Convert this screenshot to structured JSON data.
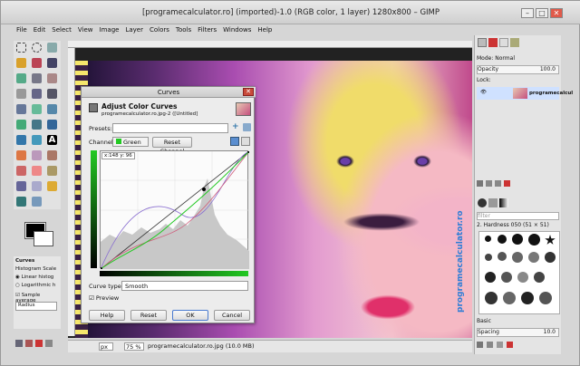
{
  "window": {
    "title": "[programecalculator.ro] (imported)-1.0 (RGB color, 1 layer) 1280x800 – GIMP"
  },
  "menubar": [
    "File",
    "Edit",
    "Select",
    "View",
    "Image",
    "Layer",
    "Colors",
    "Tools",
    "Filters",
    "Windows",
    "Help"
  ],
  "tool_options": {
    "title": "Curves",
    "histogram_scale": "Histogram Scale",
    "linear": "Linear histog",
    "log": "Logarithmic h",
    "sample": "Sample average",
    "radius": "Radius"
  },
  "canvas": {
    "watermark": "programecalculator.ro"
  },
  "statusbar": {
    "unit": "px",
    "zoom": "75 %",
    "info": "programecalculator.ro.jpg (10.0 MB)"
  },
  "curves": {
    "dialog_title": "Curves",
    "heading": "Adjust Color Curves",
    "subheading": "programecalculator.ro.jpg-2 ([Untitled]",
    "presets_label": "Presets:",
    "channel_label": "Channel:",
    "channel_value": "Green",
    "reset_channel": "Reset Channel",
    "coord": "x:148 y: 96",
    "curve_type_label": "Curve type:",
    "curve_type_value": "Smooth",
    "preview_label": "Preview",
    "help": "Help",
    "reset": "Reset",
    "ok": "OK",
    "cancel": "Cancel"
  },
  "layers": {
    "mode_label": "Mode: Normal",
    "opacity_label": "Opacity",
    "opacity_value": "100.0",
    "lock_label": "Lock:",
    "layer_name": "programecalcul"
  },
  "brushes": {
    "filter_placeholder": "filter",
    "brush_name": "2. Hardness 050 (51 × 51)",
    "mode_label": "Basic",
    "spacing_label": "Spacing",
    "spacing_value": "10.0"
  },
  "colors": {
    "accent": "#22c922",
    "selection": "#cfe1ff",
    "dialog_bg": "#ececec"
  }
}
